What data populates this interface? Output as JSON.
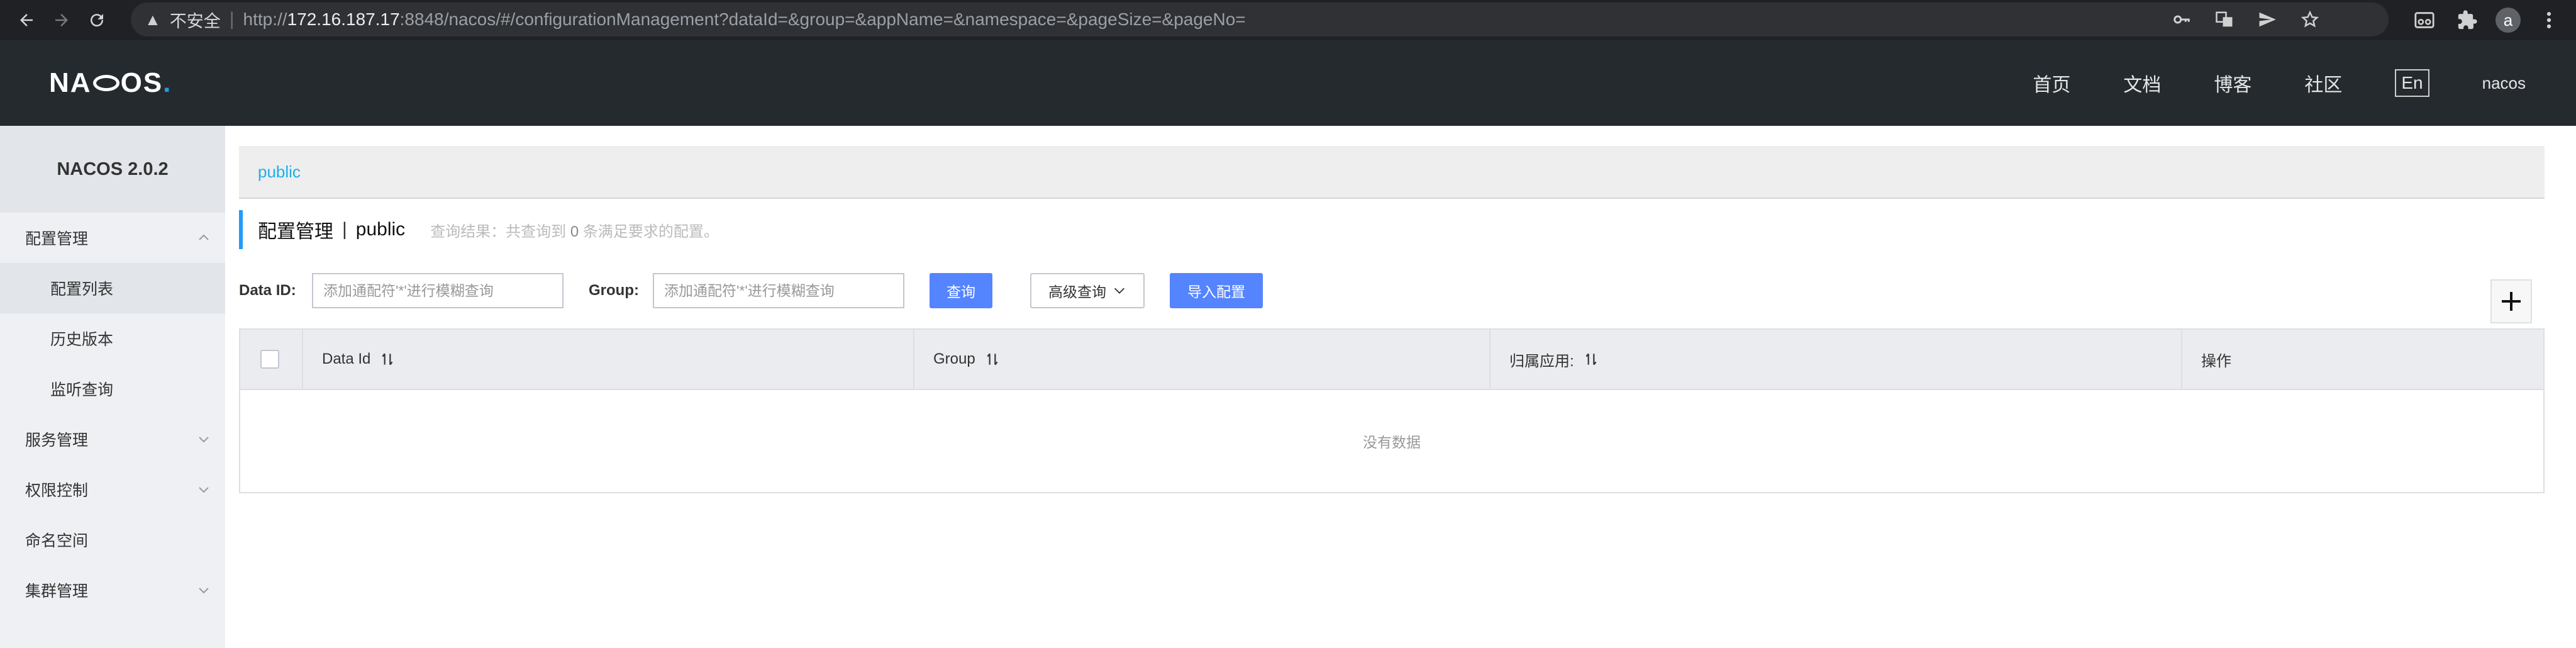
{
  "browser": {
    "security_label": "不安全",
    "url_prefix": "http://",
    "url_host": "172.16.187.17",
    "url_rest": ":8848/nacos/#/configurationManagement?dataId=&group=&appName=&namespace=&pageSize=&pageNo=",
    "profile_initial": "a"
  },
  "header": {
    "logo_text_left": "NA",
    "logo_text_right": "OS",
    "logo_dot": ".",
    "nav": [
      "首页",
      "文档",
      "博客",
      "社区"
    ],
    "lang": "En",
    "user": "nacos"
  },
  "sidebar": {
    "title": "NACOS 2.0.2",
    "items": [
      {
        "label": "配置管理",
        "icon": "chevron-up-icon"
      },
      {
        "label": "配置列表"
      },
      {
        "label": "历史版本"
      },
      {
        "label": "监听查询"
      },
      {
        "label": "服务管理",
        "icon": "chevron-down-icon"
      },
      {
        "label": "权限控制",
        "icon": "chevron-down-icon"
      },
      {
        "label": "命名空间"
      },
      {
        "label": "集群管理",
        "icon": "chevron-down-icon"
      }
    ]
  },
  "main": {
    "namespace": "public",
    "heading_title": "配置管理",
    "heading_sep": "|",
    "heading_ns": "public",
    "heading_result_prefix": "查询结果：共查询到",
    "heading_result_count": "0",
    "heading_result_suffix": "条满足要求的配置。",
    "filters": {
      "dataid_label": "Data ID:",
      "dataid_placeholder": "添加通配符'*'进行模糊查询",
      "group_label": "Group:",
      "group_placeholder": "添加通配符'*'进行模糊查询",
      "query_button": "查询",
      "advanced_button": "高级查询",
      "import_button": "导入配置"
    },
    "table": {
      "columns": [
        "Data Id",
        "Group",
        "归属应用:",
        "操作"
      ],
      "empty_text": "没有数据"
    }
  },
  "colors": {
    "header_bg": "#252a2f",
    "primary": "#5584ff",
    "accent": "#209bfa",
    "namespace_link": "#1faee8"
  }
}
